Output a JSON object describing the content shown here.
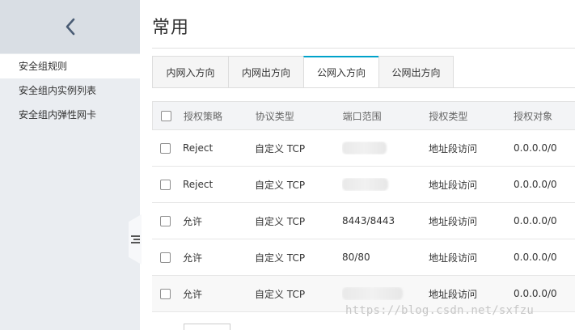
{
  "sidebar": {
    "items": [
      {
        "label": "安全组规则"
      },
      {
        "label": "安全组内实例列表"
      },
      {
        "label": "安全组内弹性网卡"
      }
    ]
  },
  "main": {
    "title": "常用",
    "tabs": [
      {
        "label": "内网入方向"
      },
      {
        "label": "内网出方向"
      },
      {
        "label": "公网入方向"
      },
      {
        "label": "公网出方向"
      }
    ],
    "active_tab": "公网入方向",
    "table": {
      "headers": [
        "授权策略",
        "协议类型",
        "端口范围",
        "授权类型",
        "授权对象"
      ],
      "rows": [
        {
          "policy": "Reject",
          "protocol": "自定义 TCP",
          "ports": "",
          "auth_type": "地址段访问",
          "auth_object": "0.0.0.0/0"
        },
        {
          "policy": "Reject",
          "protocol": "自定义 TCP",
          "ports": "",
          "auth_type": "地址段访问",
          "auth_object": "0.0.0.0/0"
        },
        {
          "policy": "允许",
          "protocol": "自定义 TCP",
          "ports": "8443/8443",
          "auth_type": "地址段访问",
          "auth_object": "0.0.0.0/0"
        },
        {
          "policy": "允许",
          "protocol": "自定义 TCP",
          "ports": "80/80",
          "auth_type": "地址段访问",
          "auth_object": "0.0.0.0/0"
        },
        {
          "policy": "允许",
          "protocol": "自定义 TCP",
          "ports": "",
          "auth_type": "地址段访问",
          "auth_object": "0.0.0.0/0"
        }
      ]
    }
  },
  "watermark": "https://blog.csdn.net/sxfzu",
  "colors": {
    "accent": "#00a2ca",
    "sidebar_bg": "#eaedf1",
    "sidebar_header_bg": "#d9dee4"
  },
  "icons": {
    "back": "chevron-left-icon",
    "collapse": "collapse-menu-icon"
  }
}
